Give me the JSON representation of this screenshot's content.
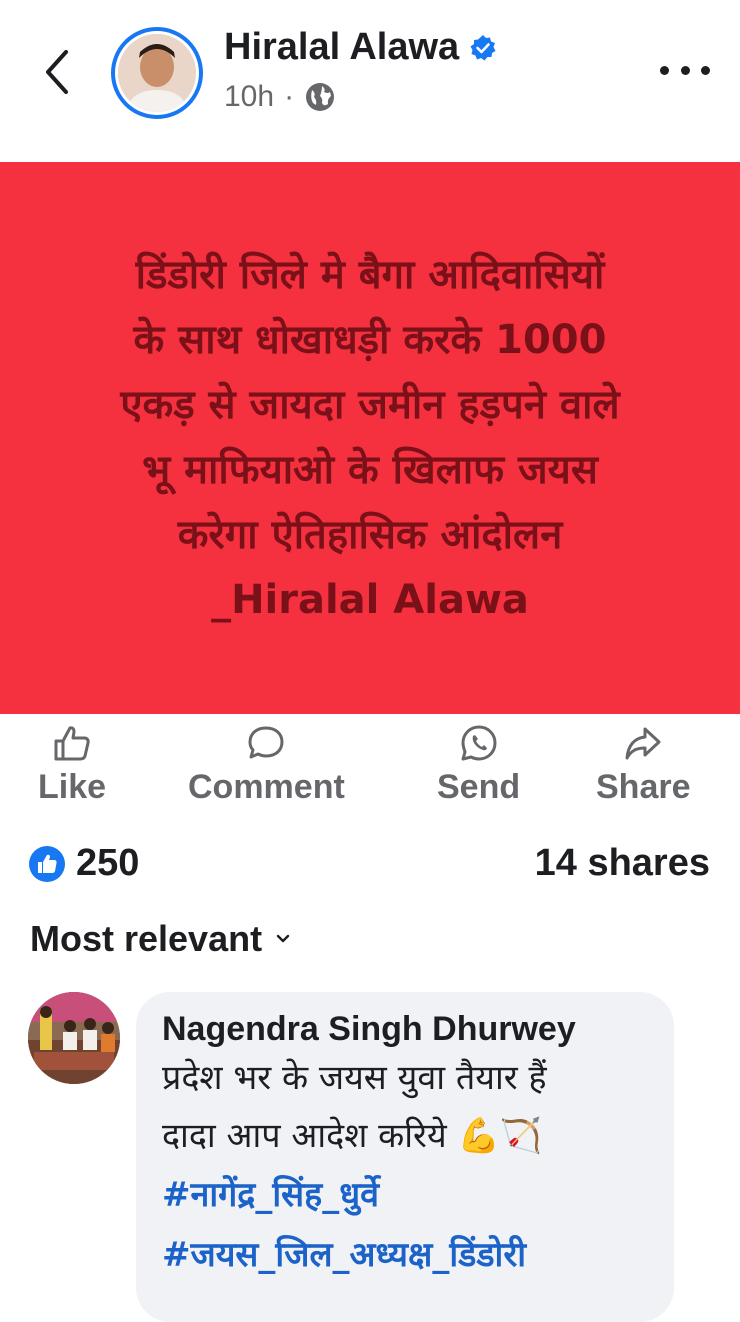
{
  "author": {
    "name": "Hiralal Alawa",
    "time": "10h",
    "separator": "·",
    "verified_icon": "verified-badge-icon",
    "privacy_icon": "globe-icon"
  },
  "post": {
    "background_color": "#f5303f",
    "text_lines": [
      "डिंडोरी जिले मे बैगा आदिवासियों",
      "के साथ धोखाधड़ी करके 1000",
      "एकड़ से जायदा जमीन हड़पने वाले",
      "भू माफियाओ के खिलाफ जयस",
      "करेगा ऐतिहासिक आंदोलन",
      "_Hiralal Alawa"
    ]
  },
  "actions": [
    {
      "label": "Like",
      "icon": "thumbs-up-icon"
    },
    {
      "label": "Comment",
      "icon": "comment-icon"
    },
    {
      "label": "Send",
      "icon": "whatsapp-icon"
    },
    {
      "label": "Share",
      "icon": "share-icon"
    }
  ],
  "stats": {
    "likes": "250",
    "shares": "14 shares"
  },
  "sort": {
    "label": "Most relevant"
  },
  "comment": {
    "name": "Nagendra Singh Dhurwey",
    "lines": [
      "प्रदेश भर के जयस युवा तैयार हैं",
      "दादा आप आदेश करिये 💪🏹"
    ],
    "hashtags": [
      "#नागेंद्र_सिंह_धुर्वे",
      "#जयस_जिल_अध्यक्ष_डिंडोरी"
    ]
  },
  "colors": {
    "accent": "#1877f2",
    "text_secondary": "#65676b",
    "hashtag": "#1b62c9"
  }
}
